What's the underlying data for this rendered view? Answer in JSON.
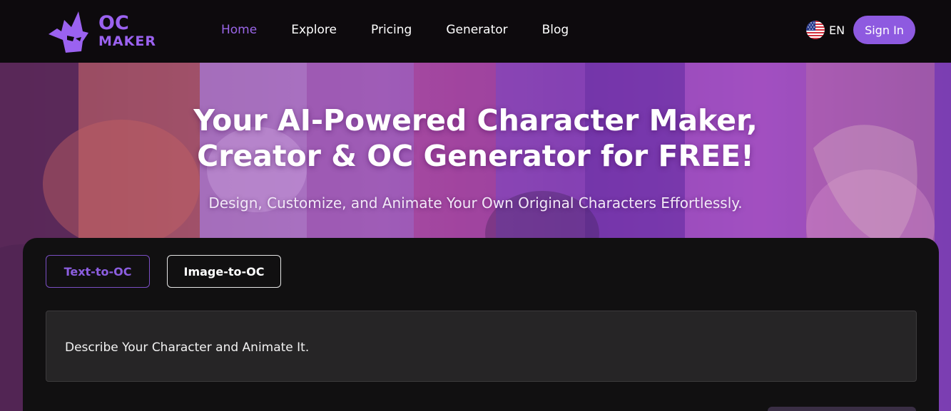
{
  "brand": {
    "logo_line1": "OC",
    "logo_line2": "MAKER",
    "accent_color": "#9b62f0"
  },
  "nav": {
    "items": [
      {
        "label": "Home",
        "active": true
      },
      {
        "label": "Explore",
        "active": false
      },
      {
        "label": "Pricing",
        "active": false
      },
      {
        "label": "Generator",
        "active": false
      },
      {
        "label": "Blog",
        "active": false
      }
    ]
  },
  "language": {
    "icon": "us-flag-icon",
    "label": "EN"
  },
  "auth": {
    "signin_label": "Sign In",
    "signin_color": "#8e5ae0"
  },
  "hero": {
    "title_line1": "Your AI-Powered Character Maker,",
    "title_line2": "Creator & OC Generator for FREE!",
    "subtitle": "Design, Customize, and Animate Your Own Original Characters Effortlessly."
  },
  "generator": {
    "tabs": [
      {
        "label": "Text-to-OC",
        "active": true
      },
      {
        "label": "Image-to-OC",
        "active": false
      }
    ],
    "prompt_placeholder": "Describe Your Character and Animate It."
  }
}
